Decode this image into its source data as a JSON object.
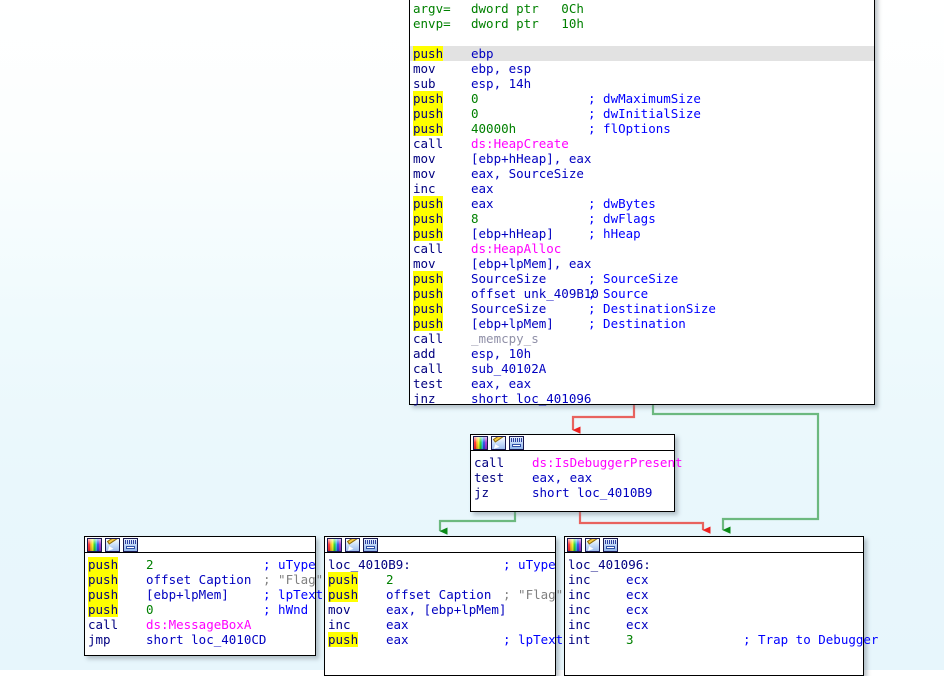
{
  "view": {
    "name": "ida-graph-view",
    "background_top": "#ffffff",
    "background_bottom": "#e7f6fc",
    "edge_true_color": "#2e9e4a",
    "edge_false_color": "#e8635e",
    "node_border_color": "#000000",
    "highlight_color": "#ffff00",
    "selection_row_color": "#e2e2e2"
  },
  "icons": {
    "palette": "color-palette-icon",
    "pencil": "edit-pencil-icon",
    "xrefs": "xrefs-window-icon"
  },
  "nodes": {
    "entry": {
      "name": "basic-block-entry",
      "lines": [
        {
          "mn": "argv=",
          "op": "dword ptr   0Ch",
          "op_class": "name",
          "kind": "vardef"
        },
        {
          "mn": "envp=",
          "op": "dword ptr   10h",
          "op_class": "name",
          "kind": "vardef"
        },
        {
          "mn": "",
          "op": "",
          "kind": "blank"
        },
        {
          "mn": "push",
          "highlight": true,
          "selected": true,
          "op": "ebp",
          "cmt": ""
        },
        {
          "mn": "mov",
          "op": "ebp, esp",
          "cmt": ""
        },
        {
          "mn": "sub",
          "op": "esp, 14h",
          "cmt": ""
        },
        {
          "mn": "push",
          "highlight": true,
          "op": "0",
          "op_class": "num",
          "cmt": "; dwMaximumSize"
        },
        {
          "mn": "push",
          "highlight": true,
          "op": "0",
          "op_class": "num",
          "cmt": "; dwInitialSize"
        },
        {
          "mn": "push",
          "highlight": true,
          "op": "40000h",
          "op_class": "num",
          "cmt": "; flOptions"
        },
        {
          "mn": "call",
          "op": "ds:HeapCreate",
          "op_class": "api",
          "cmt": ""
        },
        {
          "mn": "mov",
          "op": "[ebp+hHeap], eax",
          "cmt": ""
        },
        {
          "mn": "mov",
          "op": "eax, SourceSize",
          "cmt": ""
        },
        {
          "mn": "inc",
          "op": "eax",
          "cmt": ""
        },
        {
          "mn": "push",
          "highlight": true,
          "op": "eax",
          "cmt": "; dwBytes"
        },
        {
          "mn": "push",
          "highlight": true,
          "op": "8",
          "op_class": "num",
          "cmt": "; dwFlags"
        },
        {
          "mn": "push",
          "highlight": true,
          "op": "[ebp+hHeap]",
          "cmt": "; hHeap"
        },
        {
          "mn": "call",
          "op": "ds:HeapAlloc",
          "op_class": "api",
          "cmt": ""
        },
        {
          "mn": "mov",
          "op": "[ebp+lpMem], eax",
          "cmt": ""
        },
        {
          "mn": "push",
          "highlight": true,
          "op": "SourceSize",
          "cmt": "; SourceSize"
        },
        {
          "mn": "push",
          "highlight": true,
          "op": "offset unk_409B10",
          "cmt": "; Source"
        },
        {
          "mn": "push",
          "highlight": true,
          "op": "SourceSize",
          "cmt": "; DestinationSize"
        },
        {
          "mn": "push",
          "highlight": true,
          "op": "[ebp+lpMem]",
          "cmt": "; Destination"
        },
        {
          "mn": "call",
          "op": "_memcpy_s",
          "op_class": "libfn",
          "cmt": ""
        },
        {
          "mn": "add",
          "op": "esp, 10h",
          "cmt": ""
        },
        {
          "mn": "call",
          "op": "sub_40102A",
          "cmt": ""
        },
        {
          "mn": "test",
          "op": "eax, eax",
          "cmt": ""
        },
        {
          "mn": "jnz",
          "op": "short loc_401096",
          "cmt": ""
        }
      ]
    },
    "debugger_check": {
      "name": "basic-block-isdebuggerpresent",
      "lines": [
        {
          "mn": "call",
          "op": "ds:IsDebuggerPresent",
          "op_class": "api",
          "cmt": ""
        },
        {
          "mn": "test",
          "op": "eax, eax",
          "cmt": ""
        },
        {
          "mn": "jz",
          "op": "short loc_4010B9",
          "cmt": ""
        }
      ]
    },
    "messagebox": {
      "name": "basic-block-messagebox",
      "lines": [
        {
          "mn": "push",
          "highlight": true,
          "op": "2",
          "op_class": "num",
          "cmt": "; uType"
        },
        {
          "mn": "push",
          "highlight": true,
          "op": "offset Caption",
          "cmt": "; \"Flag\"",
          "cmt_class": "strcmt"
        },
        {
          "mn": "push",
          "highlight": true,
          "op": "[ebp+lpMem]",
          "cmt": "; lpText"
        },
        {
          "mn": "push",
          "highlight": true,
          "op": "0",
          "op_class": "num",
          "cmt": "; hWnd"
        },
        {
          "mn": "call",
          "op": "ds:MessageBoxA",
          "op_class": "api",
          "cmt": ""
        },
        {
          "mn": "jmp",
          "op": "short loc_4010CD",
          "cmt": ""
        }
      ]
    },
    "loc_4010B9": {
      "name": "basic-block-loc-4010B9",
      "label": "loc_4010B9:",
      "label_comment": "; uType",
      "lines": [
        {
          "mn": "push",
          "highlight": true,
          "op": "2",
          "op_class": "num",
          "cmt": ""
        },
        {
          "mn": "push",
          "highlight": true,
          "op": "offset Caption",
          "cmt": "; \"Flag\"",
          "cmt_class": "strcmt"
        },
        {
          "mn": "mov",
          "op": "eax, [ebp+lpMem]",
          "cmt": ""
        },
        {
          "mn": "inc",
          "op": "eax",
          "cmt": ""
        },
        {
          "mn": "push",
          "highlight": true,
          "op": "eax",
          "cmt": "; lpText"
        }
      ]
    },
    "loc_401096": {
      "name": "basic-block-loc-401096",
      "label": "loc_401096:",
      "lines": [
        {
          "mn": "inc",
          "op": "ecx",
          "cmt": ""
        },
        {
          "mn": "inc",
          "op": "ecx",
          "cmt": ""
        },
        {
          "mn": "inc",
          "op": "ecx",
          "cmt": ""
        },
        {
          "mn": "inc",
          "op": "ecx",
          "cmt": ""
        },
        {
          "mn": "int",
          "op": "3",
          "op_class": "num",
          "cmt": "; Trap to Debugger"
        }
      ]
    }
  },
  "edges": [
    {
      "name": "edge-entry-false-to-debugger-check",
      "type": "false",
      "color": "#e8635e"
    },
    {
      "name": "edge-entry-true-to-loc-401096",
      "type": "true",
      "color": "#2e9e4a"
    },
    {
      "name": "edge-debugger-true-to-loc-4010B9",
      "type": "true",
      "color": "#2e9e4a"
    },
    {
      "name": "edge-debugger-false-to-loc-401096",
      "type": "false",
      "color": "#e8635e"
    }
  ]
}
